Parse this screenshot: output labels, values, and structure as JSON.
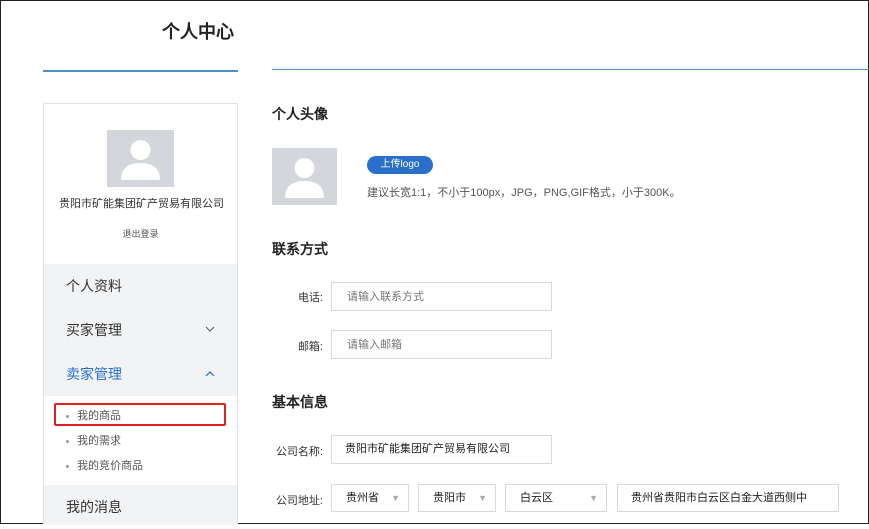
{
  "header": {
    "title": "个人中心"
  },
  "sidebar": {
    "company_name": "贵阳市矿能集团矿产贸易有限公司",
    "logout": "退出登录",
    "items": [
      {
        "label": "个人资料"
      },
      {
        "label": "买家管理",
        "icon": "chevron-down-icon"
      },
      {
        "label": "卖家管理",
        "icon": "chevron-up-icon"
      },
      {
        "label": "我的消息"
      }
    ],
    "sub_items": [
      "我的商品",
      "我的需求",
      "我的竞价商品"
    ]
  },
  "main": {
    "avatar_section": "个人头像",
    "upload_button": "上传logo",
    "upload_hint": "建议长宽1:1，不小于100px，JPG，PNG,GIF格式，小于300K。",
    "contact_section": "联系方式",
    "phone_label": "电话:",
    "phone_placeholder": "请输入联系方式",
    "email_label": "邮箱:",
    "email_placeholder": "请输入邮箱",
    "basic_section": "基本信息",
    "company_label": "公司名称:",
    "company_value": "贵阳市矿能集团矿产贸易有限公司",
    "address_label": "公司地址:",
    "province": "贵州省",
    "city": "贵阳市",
    "district": "白云区",
    "address_detail": "贵州省贵阳市白云区白金大道西侧中"
  },
  "colors": {
    "accent": "#2a6fc9",
    "highlight": "#e02020",
    "placeholder_bg": "#d3d6da"
  }
}
